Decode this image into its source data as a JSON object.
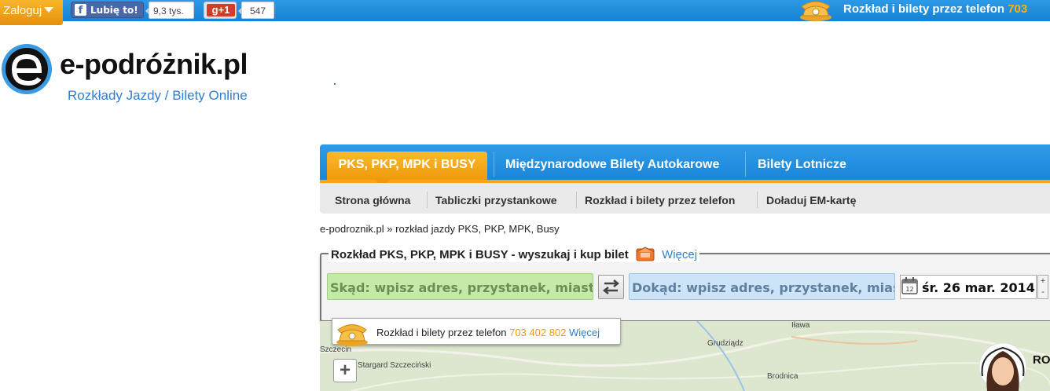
{
  "topbar": {
    "login_label": "Zaloguj",
    "fb_like_label": "Lubię to!",
    "fb_count": "9,3 tys.",
    "gplus_label": "+1",
    "gplus_count": "547",
    "phone_text": "Rozkład i bilety przez telefon ",
    "phone_number": "703"
  },
  "logo": {
    "name": "e-podróżnik.pl",
    "tagline": "Rozkłady Jazdy / Bilety Online"
  },
  "main_tabs": [
    {
      "label": "PKS, PKP, MPK i BUSY",
      "active": true
    },
    {
      "label": "Międzynarodowe Bilety Autokarowe",
      "active": false
    },
    {
      "label": "Bilety Lotnicze",
      "active": false
    }
  ],
  "sub_nav": [
    {
      "label": "Strona główna"
    },
    {
      "label": "Tabliczki przystankowe"
    },
    {
      "label": "Rozkład i bilety przez telefon"
    },
    {
      "label": "Doładuj EM-kartę"
    }
  ],
  "breadcrumb": "e-podroznik.pl » rozkład jazdy PKS, PKP, MPK, Busy",
  "search": {
    "title": "Rozkład PKS, PKP, MPK i BUSY - wyszukaj i kup bilet",
    "more_label": "Więcej",
    "from_placeholder": "Skąd: wpisz adres, przystanek, miasto...",
    "to_placeholder": "Dokąd: wpisz adres, przystanek, miasto...",
    "date_value": "śr. 26 mar. 2014",
    "stepper_plus": "+",
    "stepper_minus": "-"
  },
  "phone_popup": {
    "text": "Rozkład i bilety przez telefon ",
    "number": "703 402 802",
    "more_label": "Więcej"
  },
  "map": {
    "zoom_in_label": "+",
    "labels": [
      "Szczecin",
      "Stargard Szczeciński",
      "Iława",
      "Grudziądz",
      "Brodnica"
    ]
  },
  "promo": {
    "text": "RO"
  },
  "colors": {
    "topbar_blue": "#1f8fdf",
    "accent_orange": "#f8a414",
    "link_blue": "#2f7fce",
    "from_green": "#c3eaa6",
    "to_blue": "#cde3f8"
  }
}
